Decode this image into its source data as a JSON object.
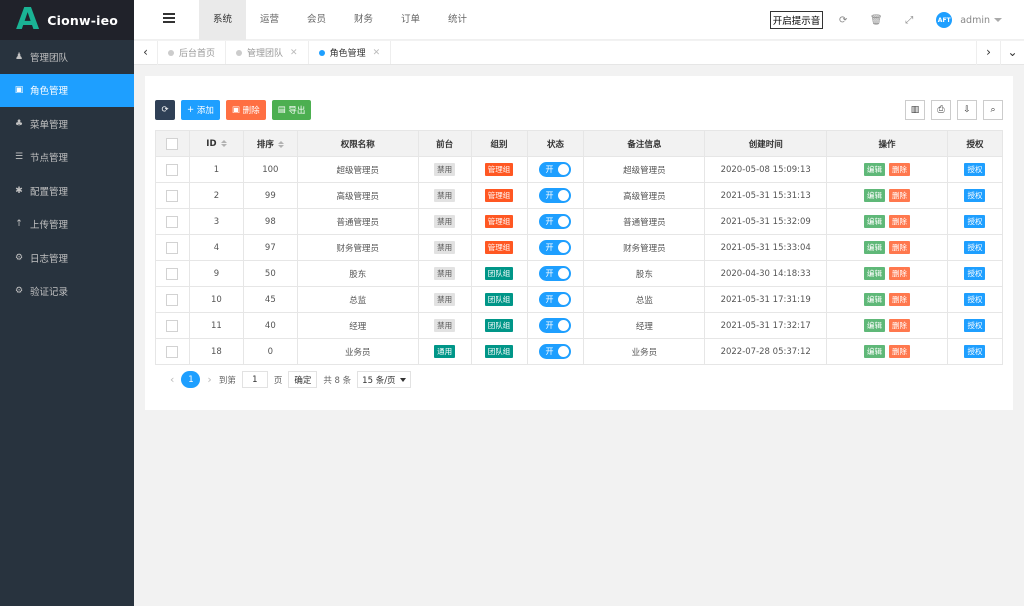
{
  "app": {
    "logo_letter": "A",
    "logo_text": "Cionw-ieo",
    "brand_color": "#1ab394"
  },
  "sidebar": {
    "items": [
      {
        "label": "管理团队",
        "icon": "user-icon",
        "glyph": "♟"
      },
      {
        "label": "角色管理",
        "icon": "id-card-icon",
        "glyph": "▣",
        "active": true
      },
      {
        "label": "菜单管理",
        "icon": "tree-icon",
        "glyph": "♣"
      },
      {
        "label": "节点管理",
        "icon": "list-icon",
        "glyph": "☰"
      },
      {
        "label": "配置管理",
        "icon": "asterisk-icon",
        "glyph": "✱"
      },
      {
        "label": "上传管理",
        "icon": "arrow-up-icon",
        "glyph": "↑"
      },
      {
        "label": "日志管理",
        "icon": "gear-icon",
        "glyph": "⚙"
      },
      {
        "label": "验证记录",
        "icon": "cog-icon",
        "glyph": "⚙"
      }
    ]
  },
  "header": {
    "nav": [
      "系统",
      "运营",
      "会员",
      "财务",
      "订单",
      "统计"
    ],
    "active_nav": "系统",
    "notify_label": "开启提示音",
    "avatar_text": "AFT",
    "username": "admin"
  },
  "tabs": [
    {
      "label": "后台首页",
      "closable": false
    },
    {
      "label": "管理团队",
      "closable": true
    },
    {
      "label": "角色管理",
      "closable": true,
      "active": true
    }
  ],
  "toolbar": {
    "add_label": "添加",
    "delete_label": "删除",
    "export_label": "导出"
  },
  "table": {
    "columns": [
      "ID",
      "排序",
      "权限名称",
      "前台",
      "组别",
      "状态",
      "备注信息",
      "创建时间",
      "操作",
      "授权"
    ],
    "rows": [
      {
        "id": "1",
        "sort": "100",
        "name": "超级管理员",
        "front": "禁用",
        "group": "管理组",
        "status": "开",
        "note": "超级管理员",
        "created": "2020-05-08 15:09:13"
      },
      {
        "id": "2",
        "sort": "99",
        "name": "高级管理员",
        "front": "禁用",
        "group": "管理组",
        "status": "开",
        "note": "高级管理员",
        "created": "2021-05-31 15:31:13"
      },
      {
        "id": "3",
        "sort": "98",
        "name": "普通管理员",
        "front": "禁用",
        "group": "管理组",
        "status": "开",
        "note": "普通管理员",
        "created": "2021-05-31 15:32:09"
      },
      {
        "id": "4",
        "sort": "97",
        "name": "财务管理员",
        "front": "禁用",
        "group": "管理组",
        "status": "开",
        "note": "财务管理员",
        "created": "2021-05-31 15:33:04"
      },
      {
        "id": "9",
        "sort": "50",
        "name": "股东",
        "front": "禁用",
        "group": "团队组",
        "status": "开",
        "note": "股东",
        "created": "2020-04-30 14:18:33"
      },
      {
        "id": "10",
        "sort": "45",
        "name": "总监",
        "front": "禁用",
        "group": "团队组",
        "status": "开",
        "note": "总监",
        "created": "2021-05-31 17:31:19"
      },
      {
        "id": "11",
        "sort": "40",
        "name": "经理",
        "front": "禁用",
        "group": "团队组",
        "status": "开",
        "note": "经理",
        "created": "2021-05-31 17:32:17"
      },
      {
        "id": "18",
        "sort": "0",
        "name": "业务员",
        "front": "通用",
        "group": "团队组",
        "status": "开",
        "note": "业务员",
        "created": "2022-07-28 05:37:12"
      }
    ],
    "action_edit": "编辑",
    "action_delete": "删除",
    "action_auth": "授权"
  },
  "pager": {
    "current": "1",
    "goto_label": "到第",
    "goto_value": "1",
    "page_unit": "页",
    "confirm_label": "确定",
    "total_label": "共 8 条",
    "page_size": "15 条/页"
  },
  "colors": {
    "primary": "#1E9FFF",
    "sidebar_bg": "#28333e",
    "danger": "#FF5722",
    "success": "#5FB878",
    "teal": "#009688"
  }
}
